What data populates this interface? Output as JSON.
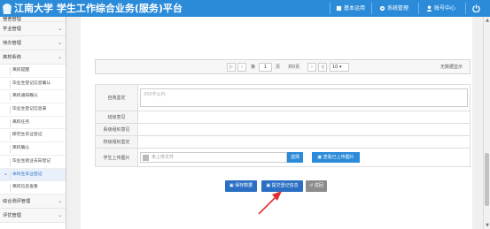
{
  "header": {
    "title": "江南大学 学生工作综合业务(服务)平台",
    "buttons": [
      {
        "label": "基本运用",
        "icon": "home-icon"
      },
      {
        "label": "系统管理",
        "icon": "gear-icon"
      },
      {
        "label": "账号中心",
        "icon": "user-icon"
      }
    ],
    "power_icon": "power-icon"
  },
  "sidebar": {
    "groups_top": [
      {
        "label": "宿舍管理"
      },
      {
        "label": "学业管理"
      },
      {
        "label": "待办管理"
      },
      {
        "label": "离校系统"
      }
    ],
    "subitems": [
      {
        "label": "离校提醒"
      },
      {
        "label": "毕业生登记信息确认"
      },
      {
        "label": "离校通知确认"
      },
      {
        "label": "毕业生登记信息表"
      },
      {
        "label": "离校任务"
      },
      {
        "label": "研究生毕业登记"
      },
      {
        "label": "离校确认"
      },
      {
        "label": "毕业生就业去向登记"
      },
      {
        "label": "本科生毕业登记",
        "active": true
      },
      {
        "label": "离校信息查看"
      }
    ],
    "groups_bottom": [
      {
        "label": "综合测评管理"
      },
      {
        "label": "评优管理"
      }
    ]
  },
  "pager": {
    "first": "|‹",
    "prev": "‹",
    "page_prefix": "第",
    "page_value": "1",
    "page_suffix": "页",
    "total": "共0页",
    "next": "›",
    "last": "›|",
    "page_size": "10",
    "empty_text": "无数据显示"
  },
  "form": {
    "rows": [
      {
        "label": "自我鉴定",
        "placeholder": "250字以内"
      },
      {
        "label": "班级意见",
        "value": ""
      },
      {
        "label": "系级组织意见",
        "value": ""
      },
      {
        "label": "校级组织鉴定",
        "value": ""
      }
    ],
    "photo": {
      "label": "学生上传图片",
      "field_placeholder": "未上传文件",
      "browse_label": "选择",
      "view_label": "查看已上传图片"
    }
  },
  "actions": {
    "save": "保存数据",
    "submit": "提交登记信息",
    "back": "返回"
  },
  "colors": {
    "header_bg": "#2b8bd9",
    "primary_button": "#2a6fc4",
    "arrow": "#e03030"
  }
}
